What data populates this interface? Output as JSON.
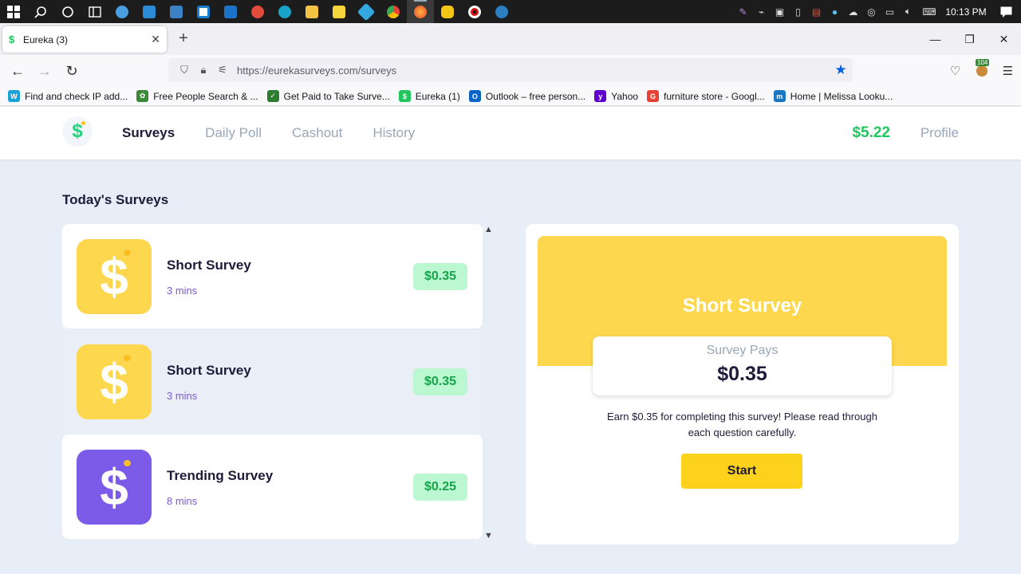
{
  "taskbar": {
    "icons": [
      "windows-icon",
      "search-icon",
      "task-view-icon",
      "widgets-icon",
      "settings-icon",
      "app-icon",
      "app-icon",
      "calendar-icon",
      "mail-icon",
      "app-icon",
      "edge-icon",
      "folder-icon",
      "sticky-icon",
      "app-icon",
      "chrome-icon",
      "firefox-icon",
      "app-icon",
      "record-icon",
      "app-icon"
    ],
    "clock": "10:13 PM"
  },
  "browser": {
    "tab_title": "Eureka (3)",
    "url": "https://eurekasurveys.com/surveys",
    "extension_badge": "104",
    "bookmarks": [
      {
        "label": "Find and check IP add...",
        "color": "#1aa1d8",
        "glyph": "W"
      },
      {
        "label": "Free People Search & ...",
        "color": "#3a8a3a",
        "glyph": "✿"
      },
      {
        "label": "Get Paid to Take Surve...",
        "color": "#2e7d32",
        "glyph": "✓"
      },
      {
        "label": "Eureka (1)",
        "color": "#22c55e",
        "glyph": "$"
      },
      {
        "label": "Outlook – free person...",
        "color": "#0a64c8",
        "glyph": "O"
      },
      {
        "label": "Yahoo",
        "color": "#5f01d1",
        "glyph": "y"
      },
      {
        "label": "furniture store - Googl...",
        "color": "#ea4335",
        "glyph": "G"
      },
      {
        "label": "Home | Melissa Looku...",
        "color": "#1a78c2",
        "glyph": "m"
      }
    ]
  },
  "site": {
    "nav": {
      "surveys": "Surveys",
      "daily_poll": "Daily Poll",
      "cashout": "Cashout",
      "history": "History"
    },
    "balance": "$5.22",
    "profile": "Profile"
  },
  "main": {
    "section_title": "Today's Surveys",
    "surveys": [
      {
        "name": "Short Survey",
        "duration": "3 mins",
        "pay": "$0.35",
        "icon_color": "#fdd84e"
      },
      {
        "name": "Short Survey",
        "duration": "3 mins",
        "pay": "$0.35",
        "icon_color": "#fdd84e"
      },
      {
        "name": "Trending Survey",
        "duration": "8 mins",
        "pay": "$0.25",
        "icon_color": "#7b5be8"
      }
    ],
    "detail": {
      "title": "Short Survey",
      "pays_label": "Survey Pays",
      "pays_amount": "$0.35",
      "description": "Earn $0.35 for completing this survey! Please read through each question carefully.",
      "start_label": "Start"
    }
  }
}
